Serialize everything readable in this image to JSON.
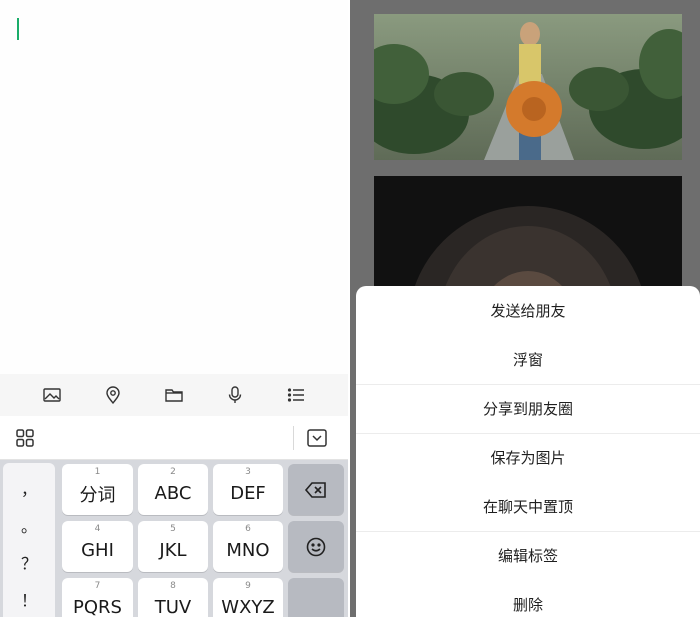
{
  "editor": {
    "toolbar_icons": [
      "image-icon",
      "location-icon",
      "folder-icon",
      "microphone-icon",
      "list-icon"
    ],
    "keyboard_top_icons": [
      "grid-icon",
      "collapse-keyboard-icon"
    ]
  },
  "keyboard": {
    "punctuation": [
      "，",
      "。",
      "？",
      "！"
    ],
    "keys": [
      {
        "num": "1",
        "label": "分词"
      },
      {
        "num": "2",
        "label": "ABC"
      },
      {
        "num": "3",
        "label": "DEF"
      },
      {
        "num": "4",
        "label": "GHI"
      },
      {
        "num": "5",
        "label": "JKL"
      },
      {
        "num": "6",
        "label": "MNO"
      },
      {
        "num": "7",
        "label": "PQRS"
      },
      {
        "num": "8",
        "label": "TUV"
      },
      {
        "num": "9",
        "label": "WXYZ"
      }
    ],
    "function_keys": [
      "backspace-icon",
      "emoji-icon"
    ]
  },
  "action_sheet": {
    "items": [
      {
        "label": "发送给朋友"
      },
      {
        "label": "浮窗"
      },
      {
        "label": "分享到朋友圈"
      },
      {
        "label": "保存为图片"
      },
      {
        "label": "在聊天中置顶"
      },
      {
        "label": "编辑标签"
      },
      {
        "label": "删除"
      }
    ]
  },
  "colors": {
    "accent": "#1aad6a",
    "overlay": "#6e6e6e",
    "keyboard_bg": "#d6d8dd"
  }
}
